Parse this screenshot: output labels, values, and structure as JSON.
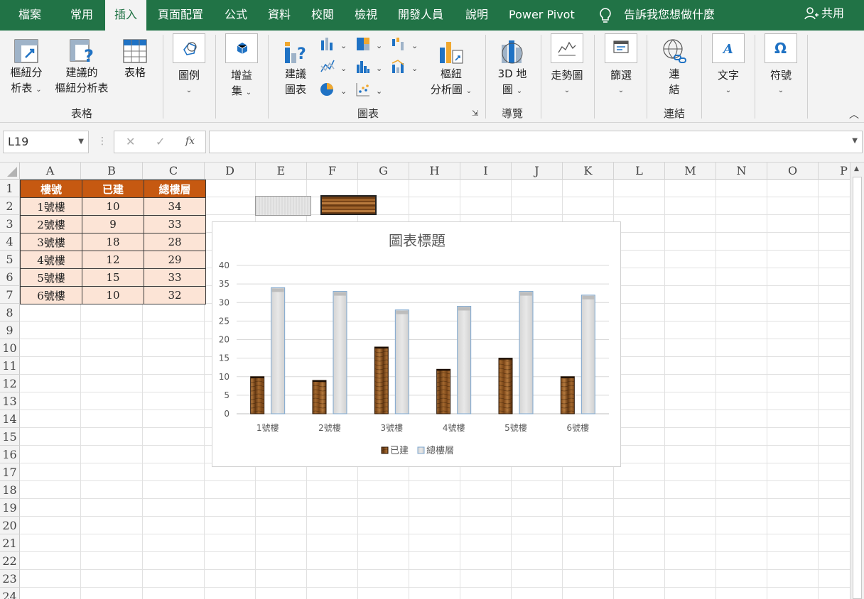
{
  "menu": {
    "tabs": [
      "檔案",
      "常用",
      "插入",
      "頁面配置",
      "公式",
      "資料",
      "校閱",
      "檢視",
      "開發人員",
      "說明",
      "Power Pivot"
    ],
    "active": "插入",
    "tell_me": "告訴我您想做什麼",
    "share": "共用"
  },
  "ribbon": {
    "pivot_table": [
      "樞紐分",
      "析表"
    ],
    "recommended_pivot": [
      "建議的",
      "樞紐分析表"
    ],
    "table": "表格",
    "group_tables": "表格",
    "illustrations": "圖例",
    "addins": [
      "增益",
      "集"
    ],
    "recommended_charts": [
      "建議",
      "圖表"
    ],
    "pivot_chart": [
      "樞紐",
      "分析圖"
    ],
    "group_charts": "圖表",
    "map3d": [
      "3D 地",
      "圖"
    ],
    "group_tours": "導覽",
    "sparklines": "走勢圖",
    "filters": "篩選",
    "link": [
      "連",
      "結"
    ],
    "group_links": "連結",
    "text": "文字",
    "symbols": "符號"
  },
  "formula_bar": {
    "name_box": "L19",
    "formula": ""
  },
  "sheet": {
    "columns": [
      "A",
      "B",
      "C",
      "D",
      "E",
      "F",
      "G",
      "H",
      "I",
      "J",
      "K",
      "L",
      "M",
      "N",
      "O",
      "P"
    ],
    "rows": [
      "1",
      "2",
      "3",
      "4",
      "5",
      "6",
      "7",
      "8",
      "9",
      "10",
      "11",
      "12",
      "13",
      "14",
      "15",
      "16",
      "17",
      "18",
      "19",
      "20",
      "21",
      "22",
      "23",
      "24"
    ],
    "table_headers": [
      "樓號",
      "已建",
      "總樓層"
    ],
    "table_rows": [
      [
        "1號樓",
        "10",
        "34"
      ],
      [
        "2號樓",
        "9",
        "33"
      ],
      [
        "3號樓",
        "18",
        "28"
      ],
      [
        "4號樓",
        "12",
        "29"
      ],
      [
        "5號樓",
        "15",
        "33"
      ],
      [
        "6號樓",
        "10",
        "32"
      ]
    ]
  },
  "colors": {
    "header_fill": "#c65911",
    "cell_fill": "#fce4d6",
    "brand": "#217346"
  },
  "chart_data": {
    "type": "bar",
    "title": "圖表標題",
    "categories": [
      "1號樓",
      "2號樓",
      "3號樓",
      "4號樓",
      "5號樓",
      "6號樓"
    ],
    "series": [
      {
        "name": "已建",
        "values": [
          10,
          9,
          18,
          12,
          15,
          10
        ]
      },
      {
        "name": "總樓層",
        "values": [
          34,
          33,
          28,
          29,
          33,
          32
        ]
      }
    ],
    "ylim": [
      0,
      40
    ],
    "yticks": [
      "0",
      "5",
      "10",
      "15",
      "20",
      "25",
      "30",
      "35",
      "40"
    ],
    "grid": true,
    "legend": "bottom"
  }
}
